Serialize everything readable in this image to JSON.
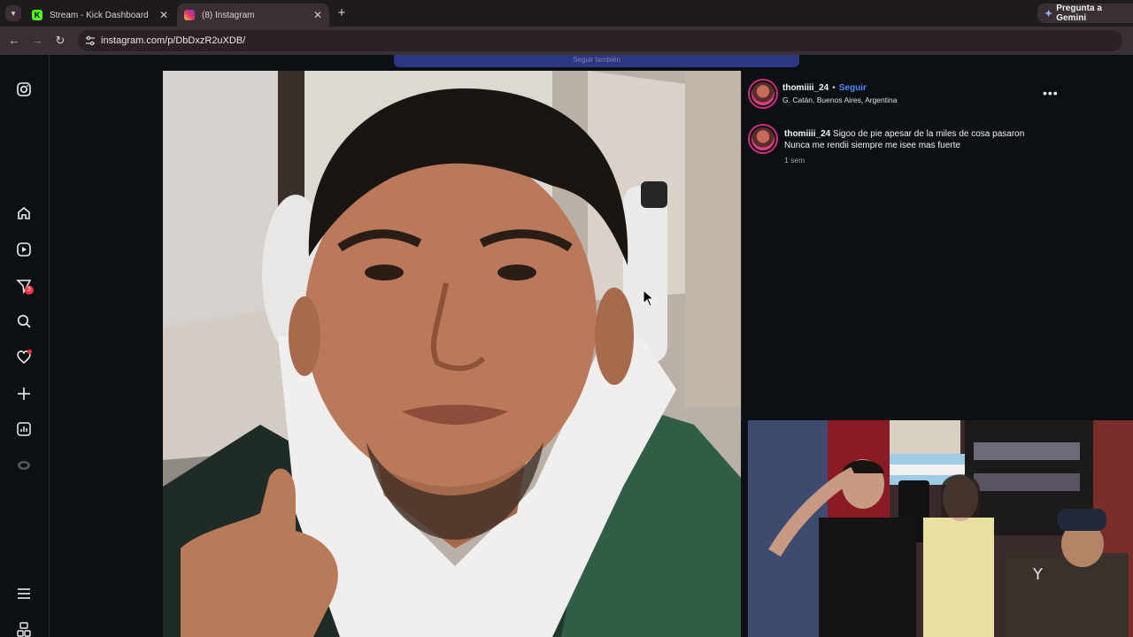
{
  "browser": {
    "tabs": [
      {
        "title": "Stream - Kick Dashboard",
        "active": false
      },
      {
        "title": "(8) Instagram",
        "active": true
      }
    ],
    "new_tab_label": "+",
    "gemini_button": "Pregunta a Gemini",
    "url": "instagram.com/p/DbDxzR2uXDB/"
  },
  "post": {
    "username": "thomiiii_24",
    "separator": "•",
    "follow_label": "Seguir",
    "location": "G. Catán, Buenos Aires, Argentina",
    "caption_username": "thomiiii_24",
    "caption_text": " Sigoo de pie apesar de la miles de cosa pasaron Nunca me rendii siempre me isee mas fuerte",
    "time_ago": "1 sem",
    "more_options": "•••",
    "top_bar_text": "Seguir también"
  },
  "sidebar": {
    "icons": [
      "instagram-icon",
      "home-icon",
      "reels-icon",
      "messages-icon",
      "search-icon",
      "notifications-icon",
      "create-icon",
      "dashboard-icon",
      "threads-icon",
      "menu-icon",
      "more-icon"
    ],
    "messages_badge": "3"
  },
  "colors": {
    "accent_blue": "#4d8cff",
    "story_ring": "#d72d7e",
    "background": "#0c1014"
  }
}
